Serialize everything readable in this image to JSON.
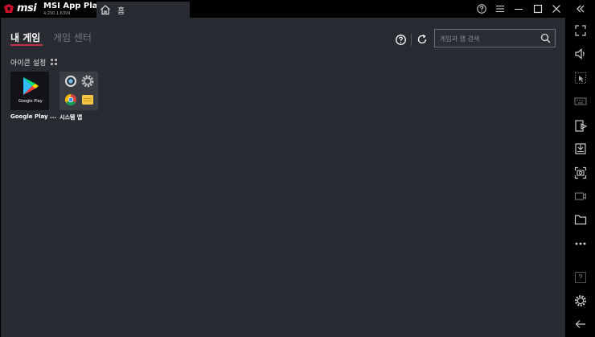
{
  "window": {
    "brand": "msi",
    "app_name": "MSI App Pla...",
    "version": "4.200.1.6309",
    "home_tab_label": "홈"
  },
  "nav": {
    "my_games": "내 게임",
    "game_center": "게임 센터"
  },
  "search": {
    "placeholder": "게임과 앱 검색"
  },
  "section": {
    "icon_settings": "아이콘 설정"
  },
  "apps": [
    {
      "label": "Google Play ...",
      "tile_text": "Google Play"
    },
    {
      "label": "시스템 앱"
    }
  ],
  "colors": {
    "background": "#282b31",
    "frame": "#000000",
    "accent": "#c23343"
  },
  "window_controls": [
    "help-icon",
    "menu-icon",
    "minimize-icon",
    "maximize-icon",
    "close-icon",
    "collapse-icon"
  ],
  "sidebar_icons": [
    "fullscreen-icon",
    "volume-icon",
    "keymapping-icon",
    "keyboard-icon",
    "apk-install-icon",
    "screen-record-save-icon",
    "screenshot-icon",
    "video-record-icon",
    "folder-icon",
    "more-icon",
    "help-icon",
    "settings-icon",
    "back-icon"
  ]
}
